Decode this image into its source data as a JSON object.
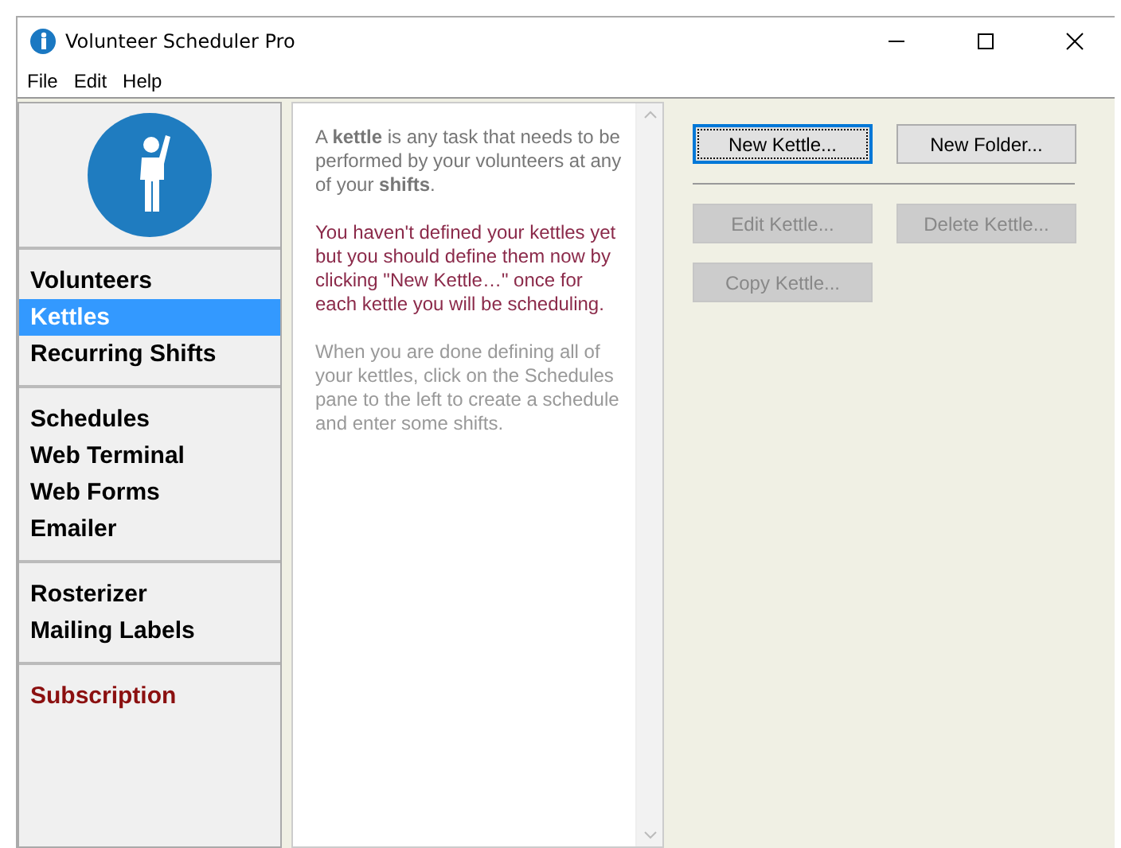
{
  "window": {
    "title": "Volunteer Scheduler Pro"
  },
  "menu": [
    "File",
    "Edit",
    "Help"
  ],
  "sidebar": {
    "groups": [
      [
        {
          "label": "Volunteers",
          "selected": false,
          "kind": "nav"
        },
        {
          "label": "Kettles",
          "selected": true,
          "kind": "nav"
        },
        {
          "label": "Recurring Shifts",
          "selected": false,
          "kind": "nav"
        }
      ],
      [
        {
          "label": "Schedules",
          "selected": false,
          "kind": "nav"
        },
        {
          "label": "Web Terminal",
          "selected": false,
          "kind": "nav"
        },
        {
          "label": "Web Forms",
          "selected": false,
          "kind": "nav"
        },
        {
          "label": "Emailer",
          "selected": false,
          "kind": "nav"
        }
      ],
      [
        {
          "label": "Rosterizer",
          "selected": false,
          "kind": "nav"
        },
        {
          "label": "Mailing Labels",
          "selected": false,
          "kind": "nav"
        }
      ],
      [
        {
          "label": "Subscription",
          "selected": false,
          "kind": "account"
        }
      ]
    ]
  },
  "help_text": [
    {
      "kind": "intro",
      "text": "A **kettle** is any task that needs to be performed by your volunteers at any of your **shifts**."
    },
    {
      "kind": "warning",
      "text": "You haven't defined your kettles yet but you should define them now by clicking \"New Kettle…\" once for each kettle you will be scheduling."
    },
    {
      "kind": "hint",
      "text": "When you are done defining all of your kettles, click on the Schedules pane to the left to create a schedule and enter some shifts."
    }
  ],
  "buttons": [
    [
      {
        "label": "New Kettle...",
        "disabled": false,
        "focused": true
      },
      {
        "label": "New Folder...",
        "disabled": false,
        "focused": false
      }
    ],
    [
      {
        "label": "Edit Kettle...",
        "disabled": true,
        "focused": false
      },
      {
        "label": "Delete Kettle...",
        "disabled": true,
        "focused": false
      }
    ],
    [
      {
        "label": "Copy Kettle...",
        "disabled": true,
        "focused": false
      }
    ]
  ]
}
